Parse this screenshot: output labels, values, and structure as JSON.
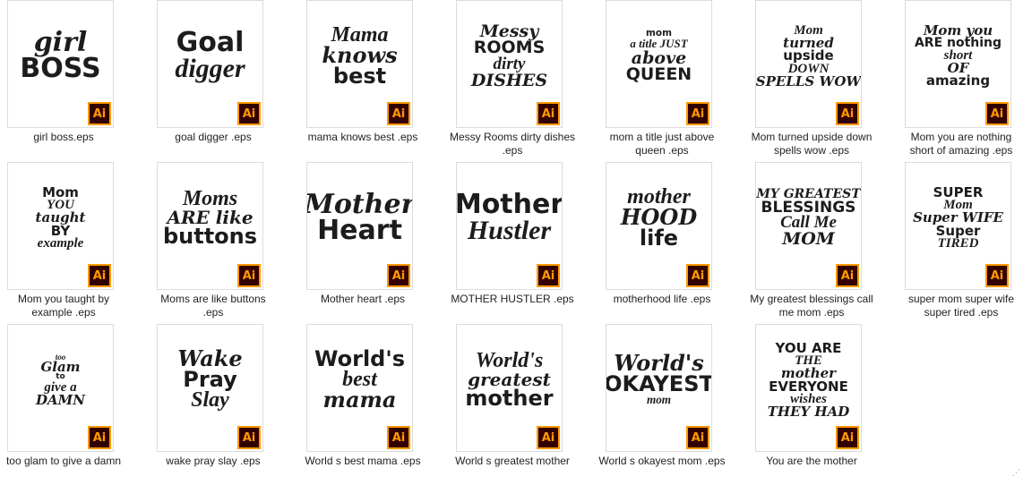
{
  "file_view": {
    "badge_label": "Ai",
    "accent": "#ff9a00",
    "badge_bg": "#330000",
    "items": [
      {
        "name": "girl boss.eps",
        "art": [
          "girl",
          "BOSS"
        ]
      },
      {
        "name": "goal digger .eps",
        "art": [
          "Goal",
          "digger"
        ]
      },
      {
        "name": "mama knows best .eps",
        "art": [
          "Mama",
          "knows",
          "best"
        ]
      },
      {
        "name": "Messy Rooms dirty dishes .eps",
        "art": [
          "Messy",
          "ROOMS",
          "dirty",
          "DISHES"
        ]
      },
      {
        "name": "mom a title just above queen .eps",
        "art": [
          "mom",
          "a title JUST",
          "above",
          "QUEEN"
        ]
      },
      {
        "name": "Mom turned upside down spells wow .eps",
        "art": [
          "Mom",
          "turned",
          "upside",
          "DOWN",
          "SPELLS WOW"
        ]
      },
      {
        "name": "Mom you are nothing short of amazing .eps",
        "art": [
          "Mom you",
          "ARE nothing",
          "short",
          "OF",
          "amazing"
        ]
      },
      {
        "name": "Mom you taught by example .eps",
        "art": [
          "Mom",
          "YOU",
          "taught",
          "BY",
          "example"
        ]
      },
      {
        "name": "Moms are like buttons .eps",
        "art": [
          "Moms",
          "ARE like",
          "buttons"
        ]
      },
      {
        "name": "Mother heart .eps",
        "art": [
          "Mother",
          "Heart"
        ]
      },
      {
        "name": "MOTHER HUSTLER .eps",
        "art": [
          "Mother",
          "Hustler"
        ]
      },
      {
        "name": "motherhood life .eps",
        "art": [
          "mother",
          "HOOD",
          "life"
        ]
      },
      {
        "name": "My greatest blessings call me mom .eps",
        "art": [
          "MY GREATEST",
          "BLESSINGS",
          "Call Me",
          "MOM"
        ]
      },
      {
        "name": "super mom super wife super tired .eps",
        "art": [
          "SUPER",
          "Mom",
          "Super WIFE",
          "Super",
          "TIRED"
        ]
      },
      {
        "name": "too glam to give a damn",
        "art": [
          "too",
          "Glam",
          "to",
          "give a",
          "DAMN"
        ]
      },
      {
        "name": "wake pray slay .eps",
        "art": [
          "Wake",
          "Pray",
          "Slay"
        ]
      },
      {
        "name": "World s best mama .eps",
        "art": [
          "World's",
          "best",
          "mama"
        ]
      },
      {
        "name": "World s greatest mother",
        "art": [
          "World's",
          "greatest",
          "mother"
        ]
      },
      {
        "name": "World s okayest mom .eps",
        "art": [
          "World's",
          "OKAYEST",
          "mom"
        ]
      },
      {
        "name": "You are the mother",
        "art": [
          "YOU ARE",
          "THE",
          "mother",
          "EVERYONE",
          "wishes",
          "THEY HAD"
        ]
      }
    ]
  }
}
